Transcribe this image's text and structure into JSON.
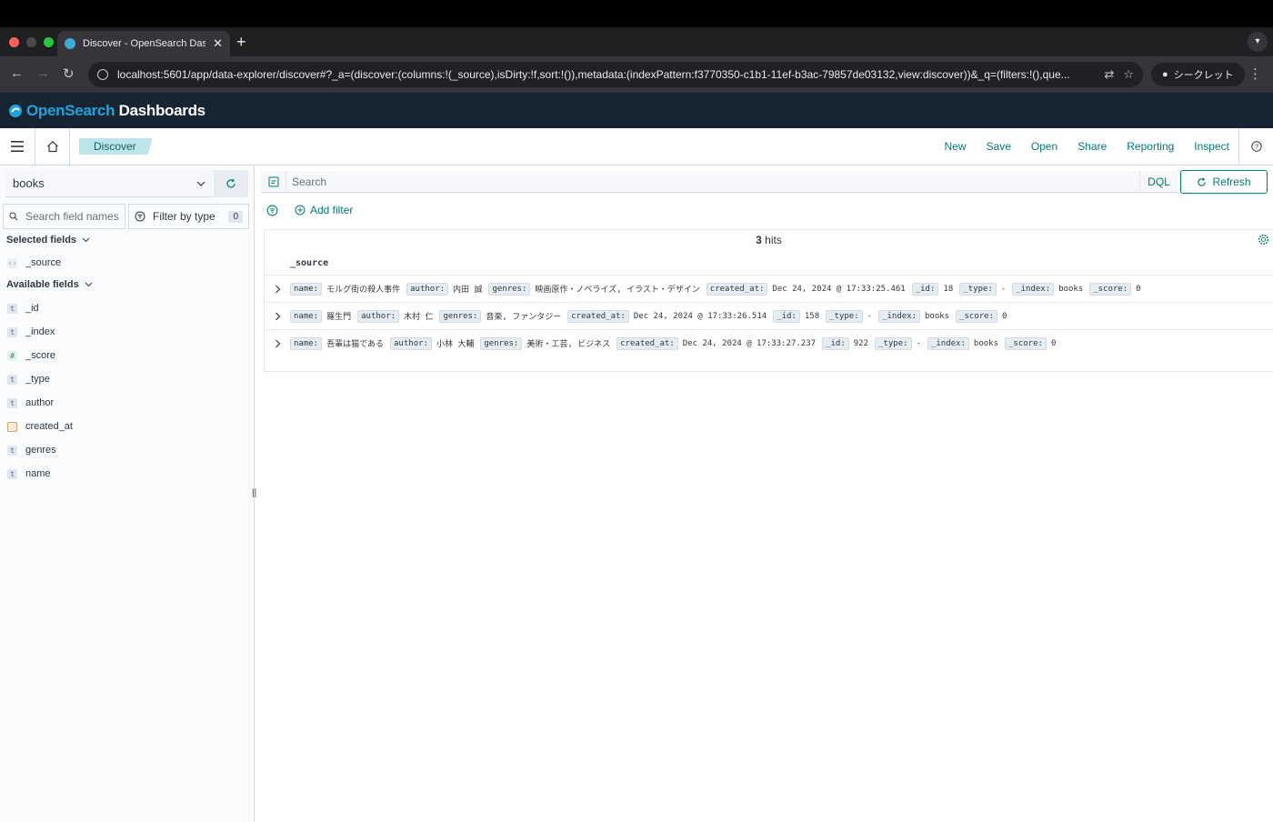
{
  "browser": {
    "tab_title": "Discover - OpenSearch Dashboards",
    "url": "localhost:5601/app/data-explorer/discover#?_a=(discover:(columns:!(_source),isDirty:!f,sort:!()),metadata:(indexPattern:f3770350-c1b1-11ef-b3ac-79857de03132,view:discover))&_q=(filters:!(),que...",
    "incognito_label": "シークレット"
  },
  "header": {
    "logo_a": "OpenSearch",
    "logo_b": "Dashboards"
  },
  "subbar": {
    "breadcrumb": "Discover",
    "actions": {
      "new": "New",
      "save": "Save",
      "open": "Open",
      "share": "Share",
      "reporting": "Reporting",
      "inspect": "Inspect"
    }
  },
  "sidebar": {
    "index_pattern": "books",
    "field_search_placeholder": "Search field names",
    "filter_by_type": "Filter by type",
    "filter_count": "0",
    "selected_title": "Selected fields",
    "available_title": "Available fields",
    "selected_fields": [
      {
        "type": "source",
        "name": "_source"
      }
    ],
    "available_fields": [
      {
        "type": "t",
        "name": "_id"
      },
      {
        "type": "t",
        "name": "_index"
      },
      {
        "type": "#",
        "name": "_score"
      },
      {
        "type": "t",
        "name": "_type"
      },
      {
        "type": "t",
        "name": "author"
      },
      {
        "type": "date",
        "name": "created_at"
      },
      {
        "type": "t",
        "name": "genres"
      },
      {
        "type": "t",
        "name": "name"
      }
    ]
  },
  "query": {
    "placeholder": "Search",
    "language": "DQL",
    "refresh_label": "Refresh",
    "add_filter": "Add filter"
  },
  "results": {
    "hits_count": "3",
    "hits_label": "hits",
    "column": "_source",
    "docs": [
      {
        "fields": [
          {
            "k": "name:",
            "v": "モルグ街の殺人事件"
          },
          {
            "k": "author:",
            "v": "内田 誠"
          },
          {
            "k": "genres:",
            "v": "映画原作・ノベライズ, イラスト・デザイン"
          },
          {
            "k": "created_at:",
            "v": "Dec 24, 2024 @ 17:33:25.461"
          },
          {
            "k": "_id:",
            "v": "18"
          },
          {
            "k": "_type:",
            "v": " - "
          },
          {
            "k": "_index:",
            "v": "books"
          },
          {
            "k": "_score:",
            "v": "0"
          }
        ]
      },
      {
        "fields": [
          {
            "k": "name:",
            "v": "羅生門"
          },
          {
            "k": "author:",
            "v": "木村 仁"
          },
          {
            "k": "genres:",
            "v": "音楽, ファンタジー"
          },
          {
            "k": "created_at:",
            "v": "Dec 24, 2024 @ 17:33:26.514"
          },
          {
            "k": "_id:",
            "v": "158"
          },
          {
            "k": "_type:",
            "v": " - "
          },
          {
            "k": "_index:",
            "v": "books"
          },
          {
            "k": "_score:",
            "v": "0"
          }
        ]
      },
      {
        "fields": [
          {
            "k": "name:",
            "v": "吾輩は猫である"
          },
          {
            "k": "author:",
            "v": "小林 大輔"
          },
          {
            "k": "genres:",
            "v": "美術・工芸, ビジネス"
          },
          {
            "k": "created_at:",
            "v": "Dec 24, 2024 @ 17:33:27.237"
          },
          {
            "k": "_id:",
            "v": "922"
          },
          {
            "k": "_type:",
            "v": " - "
          },
          {
            "k": "_index:",
            "v": "books"
          },
          {
            "k": "_score:",
            "v": "0"
          }
        ]
      }
    ]
  },
  "colors": {
    "accent": "#017d73",
    "header_bg": "#172432",
    "breadcrumb_bg": "#bce5e9"
  }
}
